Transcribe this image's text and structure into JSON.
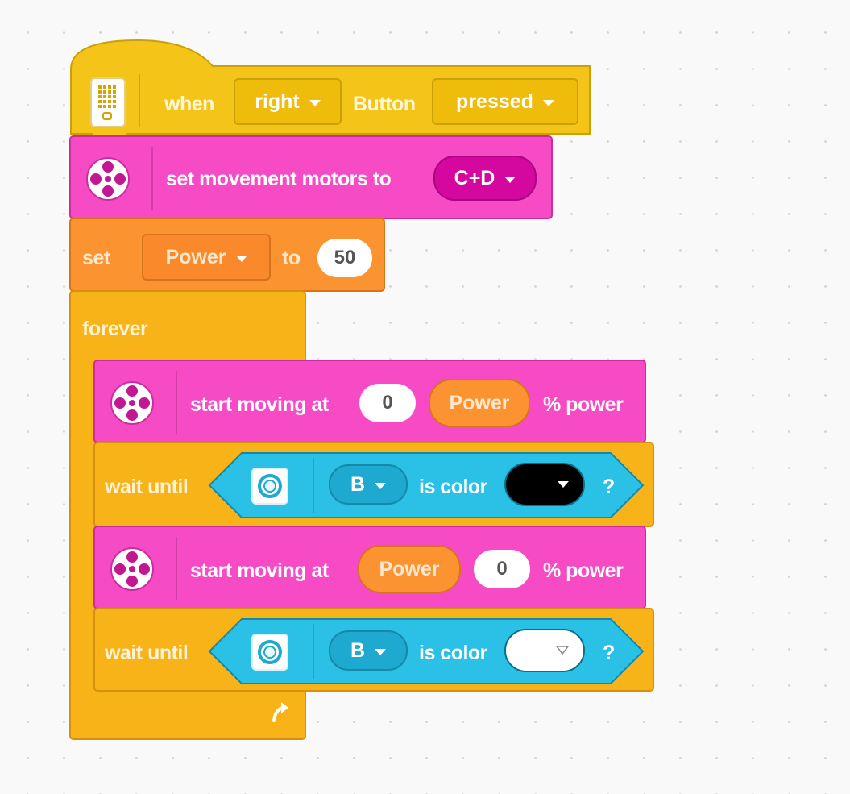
{
  "event_block": {
    "when": "when",
    "button_side": "right",
    "button": "Button",
    "action": "pressed"
  },
  "set_motors_block": {
    "label": "set movement motors to",
    "ports": "C+D"
  },
  "set_var_block": {
    "set": "set",
    "variable": "Power",
    "to": "to",
    "value": "50"
  },
  "forever_block": {
    "label": "forever"
  },
  "move_block_1": {
    "label": "start moving at",
    "steering": "0",
    "power": "Power",
    "suffix": "% power"
  },
  "wait_block_1": {
    "label": "wait until",
    "port": "B",
    "is_color": "is color",
    "color": "#000000",
    "question": "?"
  },
  "move_block_2": {
    "label": "start moving at",
    "steering": "Power",
    "power": "0",
    "suffix": "% power"
  },
  "wait_block_2": {
    "label": "wait until",
    "port": "B",
    "is_color": "is color",
    "color": "#ffffff",
    "question": "?"
  },
  "icons": {
    "hub": "hub-button-icon",
    "motor": "motor-wheel-icon",
    "sensor": "color-sensor-icon",
    "loop": "loop-arrow-icon"
  },
  "colors": {
    "event": "#f4c418",
    "motor": "#f74bc6",
    "motor_dropdown": "#d4079e",
    "variable": "#fb9331",
    "control": "#f8b318",
    "sensor": "#2bc1e6",
    "sensor_dropdown": "#1da9d0"
  }
}
